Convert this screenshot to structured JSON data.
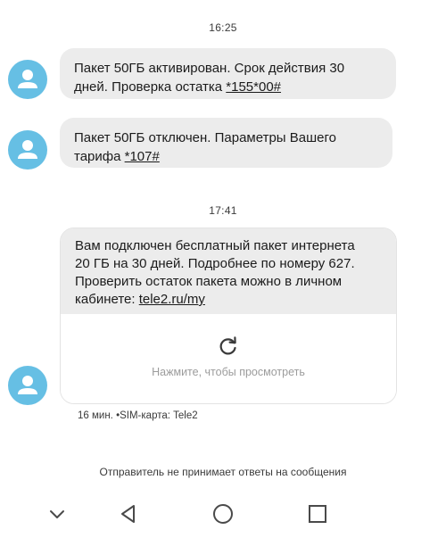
{
  "conversation": {
    "timestamps": [
      "16:25",
      "17:41"
    ],
    "messages": [
      {
        "line1": "Пакет 50ГБ активирован. Срок действия 30",
        "line2_text": "дней. Проверка остатка ",
        "line2_code": "*155*00#"
      },
      {
        "line1": "Пакет 50ГБ отключен. Параметры Вашего",
        "line2_text": "тарифа ",
        "line2_code": "*107#"
      }
    ],
    "card": {
      "lines": [
        "Вам подключен бесплатный пакет интернета",
        "20 ГБ на 30 дней. Подробнее по номеру 627.",
        "Проверить остаток пакета можно в личном"
      ],
      "line4_text": "кабинете: ",
      "line4_link": "tele2.ru/my",
      "preview_hint": "Нажмите, чтобы просмотреть",
      "refresh_icon": "refresh-icon"
    },
    "meta": {
      "time_ago": "16 мин.",
      "separator": "•",
      "sim_label": "SIM-карта: Tele2"
    },
    "notice": "Отправитель не принимает ответы на сообщения"
  },
  "colors": {
    "avatar_bg": "#66bfe4",
    "bubble_bg": "#ececec",
    "text": "#1b1b1b",
    "hint": "#9c9c9c"
  },
  "navbar": {
    "icons": [
      "chevron-down-icon",
      "back-icon",
      "home-icon",
      "recents-icon"
    ]
  }
}
